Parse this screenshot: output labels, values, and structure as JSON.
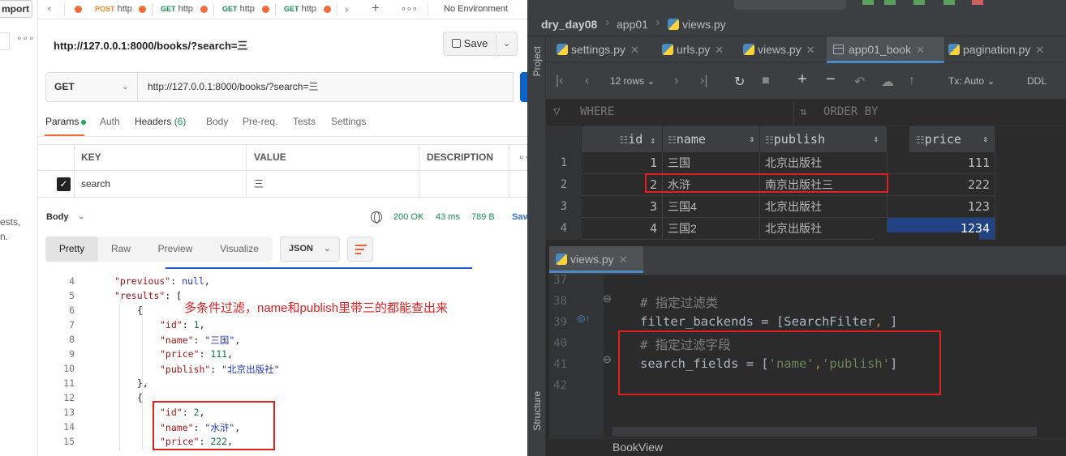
{
  "postman": {
    "sidebar": {
      "import_label": "mport",
      "dots": "∘∘∘",
      "frag1": "ests,",
      "frag2": "n."
    },
    "tabs": [
      {
        "method": "POST",
        "name": "http"
      },
      {
        "method": "GET",
        "name": "http"
      },
      {
        "method": "GET",
        "name": "http"
      },
      {
        "method": "GET",
        "name": "http"
      }
    ],
    "environment": "No Environment",
    "request_title": "http://127.0.0.1:8000/books/?search=三",
    "save_label": "Save",
    "method": "GET",
    "url": "http://127.0.0.1:8000/books/?search=三",
    "req_tabs": {
      "params": "Params",
      "auth": "Auth",
      "headers": "Headers",
      "headers_count": "(6)",
      "body": "Body",
      "prereq": "Pre-req.",
      "tests": "Tests",
      "settings": "Settings"
    },
    "params_table": {
      "key_header": "KEY",
      "value_header": "VALUE",
      "desc_header": "DESCRIPTION",
      "row": {
        "key": "search",
        "value": "三"
      }
    },
    "response": {
      "body_label": "Body",
      "status": "200 OK",
      "time": "43 ms",
      "size": "789 B",
      "save_label": "Sav"
    },
    "view_tabs": {
      "pretty": "Pretty",
      "raw": "Raw",
      "preview": "Preview",
      "visualize": "Visualize"
    },
    "format": "JSON",
    "code_lines": [
      {
        "n": "4",
        "indent": 0,
        "key": "\"previous\"",
        "sep": ": ",
        "val": "null",
        "t": "nl",
        "end": ","
      },
      {
        "n": "5",
        "indent": 0,
        "key": "\"results\"",
        "sep": ": ",
        "val": "[",
        "t": "p",
        "end": ""
      },
      {
        "n": "6",
        "indent": 1,
        "key": "",
        "sep": "",
        "val": "{",
        "t": "p",
        "end": ""
      },
      {
        "n": "7",
        "indent": 2,
        "key": "\"id\"",
        "sep": ": ",
        "val": "1",
        "t": "nm",
        "end": ","
      },
      {
        "n": "8",
        "indent": 2,
        "key": "\"name\"",
        "sep": ": ",
        "val": "\"三国\"",
        "t": "s",
        "end": ","
      },
      {
        "n": "9",
        "indent": 2,
        "key": "\"price\"",
        "sep": ": ",
        "val": "111",
        "t": "nm",
        "end": ","
      },
      {
        "n": "10",
        "indent": 2,
        "key": "\"publish\"",
        "sep": ": ",
        "val": "\"北京出版社\"",
        "t": "s",
        "end": ""
      },
      {
        "n": "11",
        "indent": 1,
        "key": "",
        "sep": "",
        "val": "},",
        "t": "p",
        "end": ""
      },
      {
        "n": "12",
        "indent": 1,
        "key": "",
        "sep": "",
        "val": "{",
        "t": "p",
        "end": ""
      },
      {
        "n": "13",
        "indent": 2,
        "key": "\"id\"",
        "sep": ": ",
        "val": "2",
        "t": "nm",
        "end": ","
      },
      {
        "n": "14",
        "indent": 2,
        "key": "\"name\"",
        "sep": ": ",
        "val": "\"水浒\"",
        "t": "s",
        "end": ","
      },
      {
        "n": "15",
        "indent": 2,
        "key": "\"price\"",
        "sep": ": ",
        "val": "222",
        "t": "nm",
        "end": ","
      }
    ],
    "annotation": "多条件过滤，name和publish里带三的都能查出来"
  },
  "pycharm": {
    "breadcrumb": {
      "project": "dry_day08",
      "app": "app01",
      "file": "views.py"
    },
    "editor_tabs": [
      {
        "name": "settings.py",
        "kind": "py"
      },
      {
        "name": "urls.py",
        "kind": "py"
      },
      {
        "name": "views.py",
        "kind": "py"
      },
      {
        "name": "app01_book",
        "kind": "table"
      },
      {
        "name": "pagination.py",
        "kind": "py"
      }
    ],
    "side_tabs": {
      "project": "Project",
      "structure": "Structure"
    },
    "db_toolbar": {
      "rows": "12 rows",
      "tx": "Tx: Auto",
      "ddl": "DDL"
    },
    "filter": {
      "where": "WHERE",
      "order": "ORDER BY"
    },
    "columns": [
      "id",
      "name",
      "publish",
      "price"
    ],
    "rows": [
      {
        "n": "1",
        "id": "1",
        "name": "三国",
        "publish": "北京出版社",
        "price": "111"
      },
      {
        "n": "2",
        "id": "2",
        "name": "水浒",
        "publish": "南京出版社三",
        "price": "222"
      },
      {
        "n": "3",
        "id": "3",
        "name": "三国4",
        "publish": "北京出版社",
        "price": "123"
      },
      {
        "n": "4",
        "id": "4",
        "name": "三国2",
        "publish": "北京出版社",
        "price": "1234"
      }
    ],
    "lower_tab": "views.py",
    "code": [
      {
        "n": "37",
        "parts": []
      },
      {
        "n": "38",
        "parts": [
          {
            "t": "cmt",
            "v": "# 指定过滤类"
          }
        ]
      },
      {
        "n": "39",
        "parts": [
          {
            "t": "p",
            "v": "filter_backends = [SearchFilter"
          },
          {
            "t": "org",
            "v": ","
          },
          {
            "t": "p",
            "v": " ]"
          }
        ]
      },
      {
        "n": "40",
        "parts": [
          {
            "t": "cmt",
            "v": "# 指定过滤字段"
          }
        ]
      },
      {
        "n": "41",
        "parts": [
          {
            "t": "p",
            "v": "search_fields = ["
          },
          {
            "t": "str",
            "v": "'name'"
          },
          {
            "t": "org",
            "v": ","
          },
          {
            "t": "str",
            "v": "'publish'"
          },
          {
            "t": "p",
            "v": "]"
          }
        ]
      },
      {
        "n": "42",
        "parts": []
      }
    ],
    "bottom_label": "BookView"
  }
}
